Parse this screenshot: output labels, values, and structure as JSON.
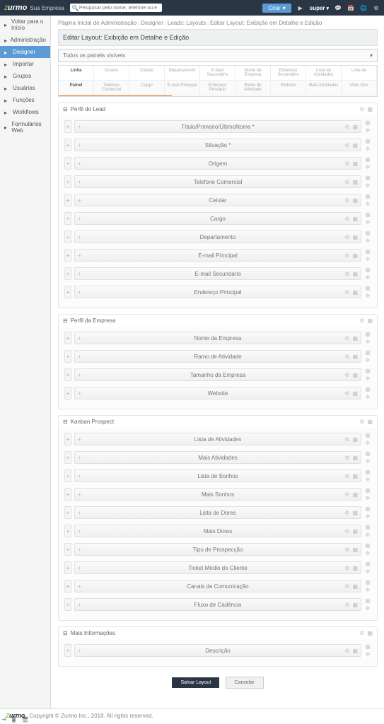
{
  "topbar": {
    "company": "Sua Empresa",
    "search_placeholder": "Pesquisar pelo nome, telefone ou e-mail",
    "create": "Criar",
    "user": "super"
  },
  "nav": {
    "items": [
      {
        "label": "Voltar para o Início"
      },
      {
        "label": "Administração"
      },
      {
        "label": "Designer",
        "active": true
      },
      {
        "label": "Importar"
      },
      {
        "label": "Grupos"
      },
      {
        "label": "Usuários"
      },
      {
        "label": "Funções"
      },
      {
        "label": "Workflows"
      },
      {
        "label": "Formulários Web"
      }
    ]
  },
  "breadcrumb": {
    "a": "Página Inicial de Administração",
    "b": "Designer",
    "c": "Leads: Layouts",
    "d": "Editar Layout: Exibição em Detalhe e Edição"
  },
  "page_title": "Editar Layout: Exibição em Detalhe e Edição",
  "dropdown": "Todos os painéis visíveis",
  "pool": {
    "row1": [
      "Linha",
      "Grupos",
      "Cidade",
      "Departamento",
      "E-Mail Secundário",
      "Nome da Empresa",
      "Endereço Secundário",
      "Lista de Atividades",
      "Lista de"
    ],
    "row2": [
      "Painel",
      "Telefone Comercial",
      "Cargo",
      "E-mail Principal",
      "Endereço Principal",
      "Ramo de Atividade",
      "Website",
      "Mais Atividades",
      "Mais Son"
    ]
  },
  "panels": [
    {
      "title": "Perfil do Lead",
      "fields": [
        "Título/Primeiro/ÚltimoNome *",
        "Situação *",
        "Origem",
        "Telefone Comercial",
        "Celular",
        "Cargo",
        "Departamento",
        "E-mail Principal",
        "E-mail Secundário",
        "Endereço Principal"
      ]
    },
    {
      "title": "Perfil da Empresa",
      "fields": [
        "Nome da Empresa",
        "Ramo de Atividade",
        "Tamanho da Empresa",
        "Website"
      ]
    },
    {
      "title": "Kanban Prospect",
      "fields": [
        "Lista de Atividades",
        "Mais Atividades",
        "Lista de Sonhos",
        "Mais Sonhos",
        "Lista de Dores",
        "Mais Dores",
        "Tipo de Prospecção",
        "Ticket Médio do Cliente",
        "Canais de Comunicação",
        "Fluxo de Cadência"
      ]
    },
    {
      "title": "Mais Informações",
      "fields": [
        "Descrição"
      ]
    }
  ],
  "buttons": {
    "save": "Salvar Layout",
    "cancel": "Cancelar"
  },
  "footer": "Copyright © Zurmo Inc., 2018. All rights reserved."
}
